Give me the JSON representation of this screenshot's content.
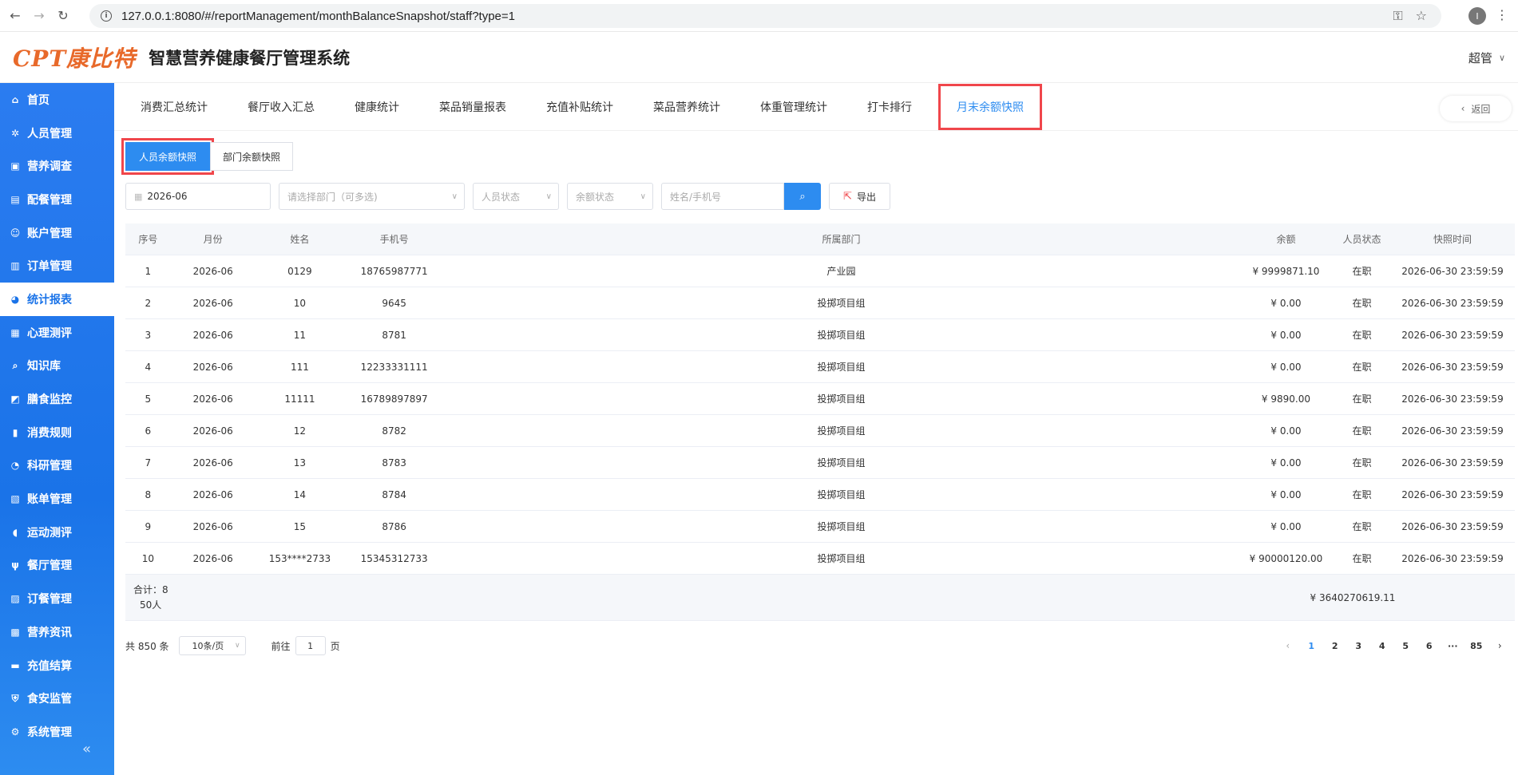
{
  "browser": {
    "url": "127.0.0.1:8080/#/reportManagement/monthBalanceSnapshot/staff?type=1",
    "profile_initial": "I"
  },
  "header": {
    "logo": "CPT康比特",
    "title": "智慧营养健康餐厅管理系统",
    "user": "超管"
  },
  "sidebar": {
    "items": [
      {
        "label": "首页",
        "icon": "home-icon",
        "glyph": "⌂"
      },
      {
        "label": "人员管理",
        "icon": "settings-circle-icon",
        "glyph": "✲"
      },
      {
        "label": "营养调查",
        "icon": "survey-icon",
        "glyph": "▣"
      },
      {
        "label": "配餐管理",
        "icon": "meal-plan-icon",
        "glyph": "▤"
      },
      {
        "label": "账户管理",
        "icon": "account-icon",
        "glyph": "☺"
      },
      {
        "label": "订单管理",
        "icon": "order-icon",
        "glyph": "▥"
      },
      {
        "label": "统计报表",
        "icon": "pie-chart-icon",
        "glyph": "◕"
      },
      {
        "label": "心理测评",
        "icon": "psych-icon",
        "glyph": "▦"
      },
      {
        "label": "知识库",
        "icon": "knowledge-icon",
        "glyph": "⌕"
      },
      {
        "label": "膳食监控",
        "icon": "monitor-icon",
        "glyph": "◩"
      },
      {
        "label": "消费规则",
        "icon": "bar-chart-icon",
        "glyph": "▮"
      },
      {
        "label": "科研管理",
        "icon": "research-icon",
        "glyph": "◔"
      },
      {
        "label": "账单管理",
        "icon": "bill-icon",
        "glyph": "▧"
      },
      {
        "label": "运动测评",
        "icon": "sport-icon",
        "glyph": "◖"
      },
      {
        "label": "餐厅管理",
        "icon": "fork-knife-icon",
        "glyph": "ψ"
      },
      {
        "label": "订餐管理",
        "icon": "booking-icon",
        "glyph": "▨"
      },
      {
        "label": "营养资讯",
        "icon": "news-icon",
        "glyph": "▩"
      },
      {
        "label": "充值结算",
        "icon": "wallet-icon",
        "glyph": "▬"
      },
      {
        "label": "食安监管",
        "icon": "shield-icon",
        "glyph": "⛨"
      },
      {
        "label": "系统管理",
        "icon": "gear-icon",
        "glyph": "⚙"
      }
    ],
    "active_index": 6,
    "collapse": "«"
  },
  "top_tabs": {
    "items": [
      "消费汇总统计",
      "餐厅收入汇总",
      "健康统计",
      "菜品销量报表",
      "充值补贴统计",
      "菜品营养统计",
      "体重管理统计",
      "打卡排行",
      "月末余额快照"
    ],
    "active": "月末余额快照",
    "back": "返回"
  },
  "sub_tabs": {
    "staff": "人员余额快照",
    "dept": "部门余额快照"
  },
  "filters": {
    "date_value": "2026-06",
    "dept_placeholder": "请选择部门（可多选)",
    "staff_status_placeholder": "人员状态",
    "balance_status_placeholder": "余额状态",
    "name_placeholder": "姓名/手机号",
    "export": "导出"
  },
  "table": {
    "headers": [
      "序号",
      "月份",
      "姓名",
      "手机号",
      "所属部门",
      "余额",
      "人员状态",
      "快照时间"
    ],
    "rows": [
      [
        "1",
        "2026-06",
        "0129",
        "18765987771",
        "产业园",
        "¥ 9999871.10",
        "在职",
        "2026-06-30 23:59:59"
      ],
      [
        "2",
        "2026-06",
        "10",
        "9645",
        "投掷项目组",
        "¥ 0.00",
        "在职",
        "2026-06-30 23:59:59"
      ],
      [
        "3",
        "2026-06",
        "11",
        "8781",
        "投掷项目组",
        "¥ 0.00",
        "在职",
        "2026-06-30 23:59:59"
      ],
      [
        "4",
        "2026-06",
        "111",
        "12233331111",
        "投掷项目组",
        "¥ 0.00",
        "在职",
        "2026-06-30 23:59:59"
      ],
      [
        "5",
        "2026-06",
        "11111",
        "16789897897",
        "投掷项目组",
        "¥ 9890.00",
        "在职",
        "2026-06-30 23:59:59"
      ],
      [
        "6",
        "2026-06",
        "12",
        "8782",
        "投掷项目组",
        "¥ 0.00",
        "在职",
        "2026-06-30 23:59:59"
      ],
      [
        "7",
        "2026-06",
        "13",
        "8783",
        "投掷项目组",
        "¥ 0.00",
        "在职",
        "2026-06-30 23:59:59"
      ],
      [
        "8",
        "2026-06",
        "14",
        "8784",
        "投掷项目组",
        "¥ 0.00",
        "在职",
        "2026-06-30 23:59:59"
      ],
      [
        "9",
        "2026-06",
        "15",
        "8786",
        "投掷项目组",
        "¥ 0.00",
        "在职",
        "2026-06-30 23:59:59"
      ],
      [
        "10",
        "2026-06",
        "153****2733",
        "15345312733",
        "投掷项目组",
        "¥ 90000120.00",
        "在职",
        "2026-06-30 23:59:59"
      ]
    ],
    "footer": {
      "total_label": "合计：8",
      "people": "50人",
      "balance_total": "¥ 3640270619.11"
    }
  },
  "pagination": {
    "total": "共 850 条",
    "page_size": "10条/页",
    "goto_prefix": "前往",
    "goto_value": "1",
    "goto_suffix": "页",
    "pages": [
      "1",
      "2",
      "3",
      "4",
      "5",
      "6",
      "···",
      "85"
    ],
    "current": "1"
  }
}
